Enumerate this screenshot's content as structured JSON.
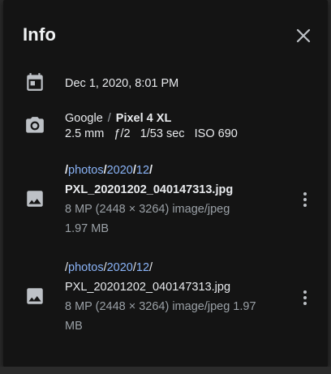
{
  "dialog": {
    "title": "Info",
    "close_icon": "close-icon"
  },
  "date_row": {
    "icon": "calendar-icon",
    "text": "Dec 1, 2020, 8:01 PM"
  },
  "camera_row": {
    "icon": "camera-icon",
    "make": "Google",
    "separator": "/",
    "model": "Pixel 4 XL",
    "focal_length": "2.5 mm",
    "aperture": "ƒ/2",
    "exposure": "1/53 sec",
    "iso": "ISO 690"
  },
  "files": [
    {
      "icon": "image-icon",
      "path_prefix": "/",
      "path_parts": [
        "photos",
        "2020",
        "12"
      ],
      "path_seps": [
        "/",
        "/",
        "/"
      ],
      "filename": "PXL_20201202_040147313.jpg",
      "meta_line1": "8 MP (2448 × 3264) image/jpeg",
      "meta_line2": "1.97 MB",
      "more_icon": "more-vert-icon"
    },
    {
      "icon": "image-icon",
      "path_prefix": "/",
      "path_parts": [
        "photos",
        "2020",
        "12"
      ],
      "path_seps": [
        "/",
        "/",
        "/"
      ],
      "filename": "PXL_20201202_040147313.jpg",
      "meta_line1": "8 MP (2448 × 3264) image/jpeg 1.97",
      "meta_line2": "MB",
      "more_icon": "more-vert-icon"
    }
  ],
  "colors": {
    "panel_bg": "#141414",
    "text": "#e8eaed",
    "muted": "#9aa0a6",
    "link": "#8ab4f8",
    "icon": "#bdc1c6"
  }
}
